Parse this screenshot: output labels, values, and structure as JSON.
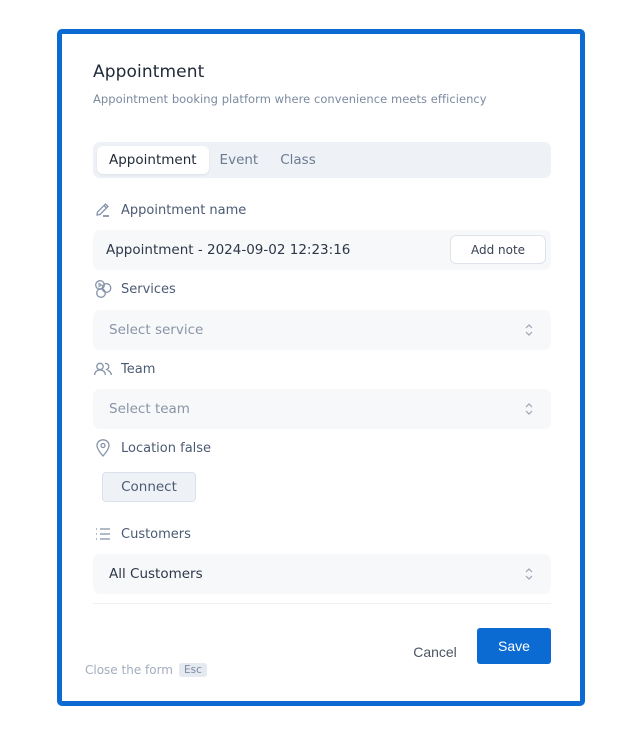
{
  "header": {
    "title": "Appointment",
    "subtitle": "Appointment booking platform where convenience meets efficiency"
  },
  "tabs": [
    {
      "label": "Appointment",
      "active": true
    },
    {
      "label": "Event",
      "active": false
    },
    {
      "label": "Class",
      "active": false
    }
  ],
  "fields": {
    "name": {
      "label": "Appointment name",
      "icon": "pencil-icon",
      "value": "Appointment - 2024-09-02 12:23:16",
      "add_note_label": "Add note"
    },
    "services": {
      "label": "Services",
      "icon": "services-icon",
      "placeholder": "Select service"
    },
    "team": {
      "label": "Team",
      "icon": "users-icon",
      "placeholder": "Select team"
    },
    "location": {
      "label": "Location false",
      "icon": "map-pin-icon",
      "connect_label": "Connect"
    },
    "customers": {
      "label": "Customers",
      "icon": "list-icon",
      "value": "All Customers"
    }
  },
  "footer": {
    "cancel_label": "Cancel",
    "save_label": "Save",
    "close_hint": "Close the form",
    "close_key": "Esc"
  },
  "colors": {
    "accent": "#0b6bd3",
    "tab_bg": "#eef2f7",
    "field_bg": "#f7f8fa"
  }
}
